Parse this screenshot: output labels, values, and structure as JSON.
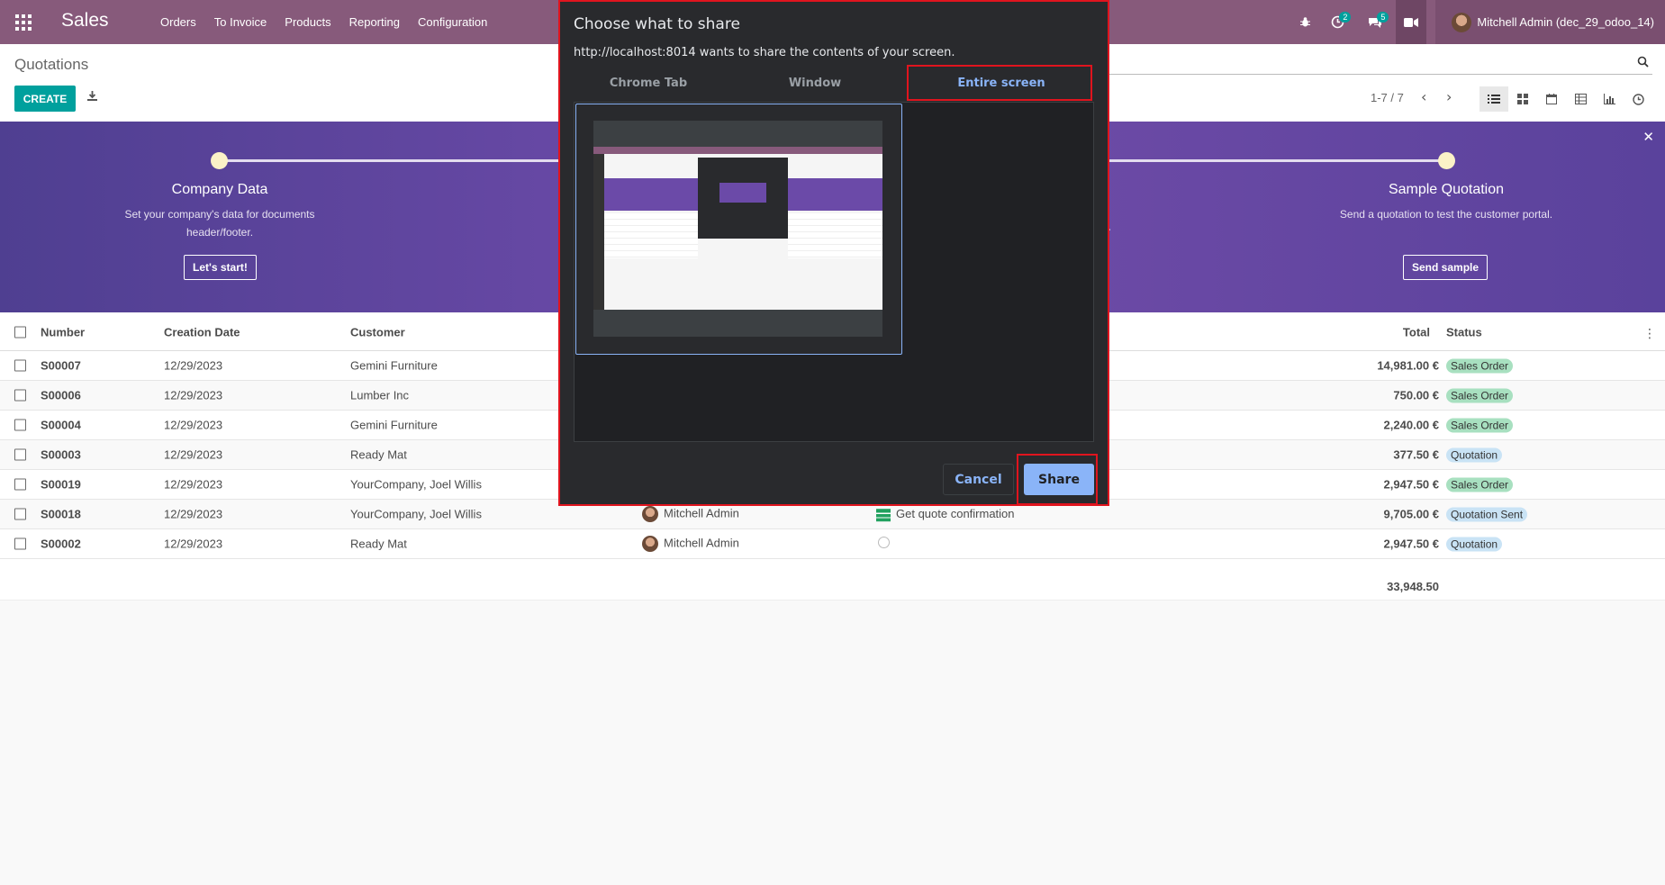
{
  "navbar": {
    "brand": "Sales",
    "menu": [
      "Orders",
      "To Invoice",
      "Products",
      "Reporting",
      "Configuration"
    ],
    "activity_count": "2",
    "messages_count": "5",
    "user": "Mitchell Admin (dec_29_odoo_14)"
  },
  "control": {
    "breadcrumb": "Quotations",
    "create_label": "CREATE",
    "pager": "1-7 / 7"
  },
  "banner": {
    "step1": {
      "title": "Company Data",
      "desc": "Set your company's data for documents header/footer.",
      "button": "Let's start!"
    },
    "step2": {
      "title": "Sample Quotation",
      "desc": "Send a quotation to test the customer portal.",
      "button": "Send sample"
    },
    "partial_char": "."
  },
  "table": {
    "headers": {
      "number": "Number",
      "date": "Creation Date",
      "customer": "Customer",
      "total": "Total",
      "status": "Status"
    },
    "rows": [
      {
        "number": "S00007",
        "date": "12/29/2023",
        "customer": "Gemini Furniture",
        "salesperson": "",
        "activity": "",
        "total": "14,981.00 €",
        "status": "Sales Order"
      },
      {
        "number": "S00006",
        "date": "12/29/2023",
        "customer": "Lumber Inc",
        "salesperson": "",
        "activity": "",
        "total": "750.00 €",
        "status": "Sales Order"
      },
      {
        "number": "S00004",
        "date": "12/29/2023",
        "customer": "Gemini Furniture",
        "salesperson": "",
        "activity": "",
        "total": "2,240.00 €",
        "status": "Sales Order"
      },
      {
        "number": "S00003",
        "date": "12/29/2023",
        "customer": "Ready Mat",
        "salesperson": "",
        "activity": "",
        "total": "377.50 €",
        "status": "Quotation"
      },
      {
        "number": "S00019",
        "date": "12/29/2023",
        "customer": "YourCompany, Joel Willis",
        "salesperson": "",
        "activity": "",
        "total": "2,947.50 €",
        "status": "Sales Order"
      },
      {
        "number": "S00018",
        "date": "12/29/2023",
        "customer": "YourCompany, Joel Willis",
        "salesperson": "Mitchell Admin",
        "activity": "Get quote confirmation",
        "total": "9,705.00 €",
        "status": "Quotation Sent"
      },
      {
        "number": "S00002",
        "date": "12/29/2023",
        "customer": "Ready Mat",
        "salesperson": "Mitchell Admin",
        "activity": "",
        "total": "2,947.50 €",
        "status": "Quotation"
      }
    ],
    "sum_total": "33,948.50"
  },
  "dialog": {
    "title": "Choose what to share",
    "subtitle": "http://localhost:8014 wants to share the contents of your screen.",
    "tabs": [
      "Chrome Tab",
      "Window",
      "Entire screen"
    ],
    "cancel_label": "Cancel",
    "share_label": "Share"
  },
  "colors": {
    "navbar": "#875a7b",
    "primary": "#00a09d",
    "dialog_bg": "#292a2d",
    "dialog_accent": "#8ab4f8",
    "highlight": "#e0141e"
  }
}
